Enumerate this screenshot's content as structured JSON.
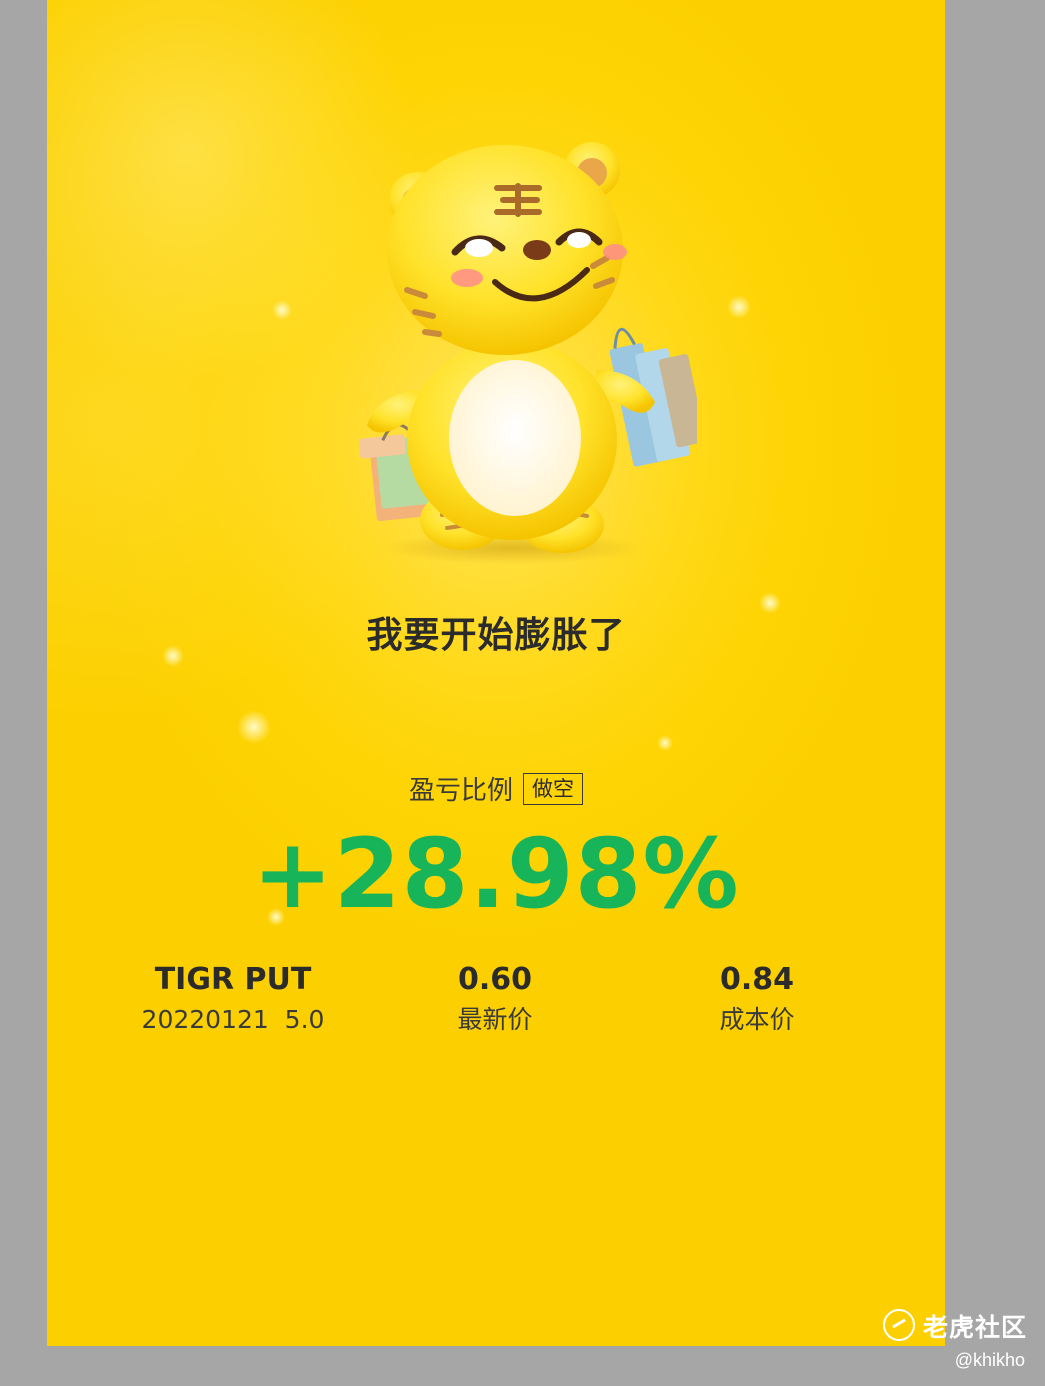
{
  "headline": "我要开始膨胀了",
  "pl": {
    "label": "盈亏比例",
    "tag": "做空",
    "ratio": "+28.98%"
  },
  "stats": {
    "symbol": "TIGR PUT",
    "contract": "20220121  5.0",
    "last_price": "0.60",
    "last_price_label": "最新价",
    "cost_price": "0.84",
    "cost_price_label": "成本价"
  },
  "watermark": {
    "brand": "老虎社区",
    "handle": "@khikho"
  },
  "colors": {
    "background": "#fed404",
    "gain_green": "#18b45a",
    "frame_gray": "#a6a6a6"
  },
  "icons": {
    "mascot": "tiger-mascot-with-shopping-bags",
    "brand_logo": "tiger-logo-icon"
  }
}
